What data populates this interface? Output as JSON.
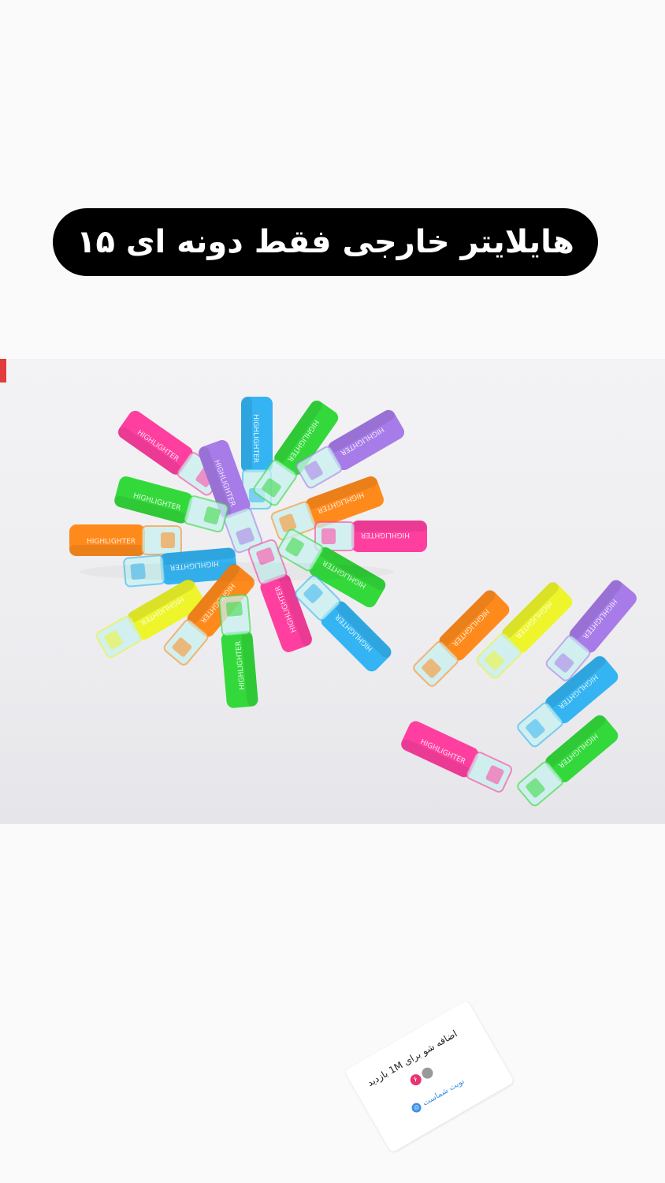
{
  "banner": {
    "title": "هایلایتر خارجی فقط دونه ای ۱۵"
  },
  "product": {
    "marker_text": "HIGHLIGHTER",
    "colors": {
      "pink": "#ff3fa0",
      "green": "#33d93b",
      "blue": "#34b4f2",
      "purple": "#a77be8",
      "orange": "#ff8a1c",
      "yellow": "#eef52a",
      "cap": "#c8f0ef"
    }
  },
  "sticker": {
    "text": "اضافه شو برای 1M بازدید",
    "badge": "۶",
    "action_label": "نوبت شماست"
  }
}
